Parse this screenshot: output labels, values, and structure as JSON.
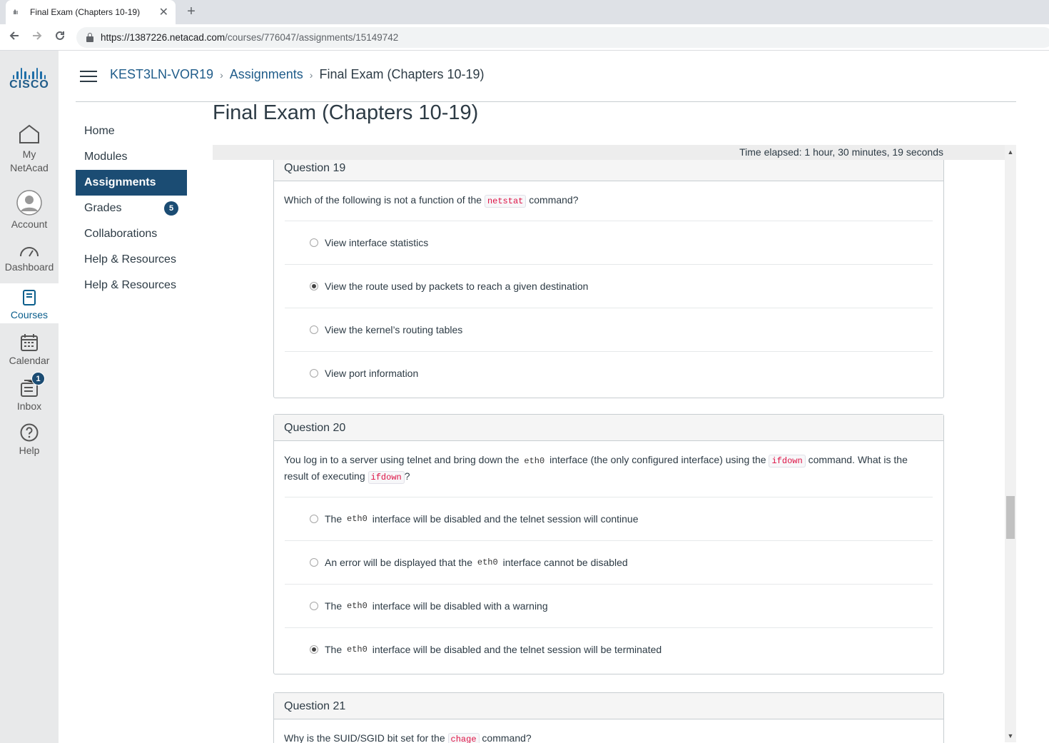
{
  "browser": {
    "tab_title": "Final Exam (Chapters 10-19)",
    "tab_close": "✕",
    "new_tab": "+",
    "url_host": "https://1387226.netacad.com",
    "url_path": "/courses/776047/assignments/15149742"
  },
  "global_nav": {
    "logo_text": "CISCO",
    "items": [
      {
        "label": "My NetAcad"
      },
      {
        "label": "Account"
      },
      {
        "label": "Dashboard"
      },
      {
        "label": "Courses"
      },
      {
        "label": "Calendar"
      },
      {
        "label": "Inbox",
        "badge": "1"
      },
      {
        "label": "Help"
      }
    ]
  },
  "breadcrumb": {
    "course": "KEST3LN-VOR19",
    "section": "Assignments",
    "current": "Final Exam (Chapters 10-19)",
    "separator": "›"
  },
  "course_nav": {
    "items": [
      "Home",
      "Modules",
      "Assignments",
      "Grades",
      "Collaborations",
      "Help & Resources",
      "Help & Resources"
    ],
    "grades_badge": "5"
  },
  "page_title": "Final Exam (Chapters 10-19)",
  "timer": "Time elapsed: 1 hour, 30 minutes, 19 seconds",
  "questions": [
    {
      "title": "Question 19",
      "text_pre": "Which of the following is not a function of the ",
      "text_code": "netstat",
      "text_post": " command?",
      "answers": [
        {
          "text": "View interface statistics",
          "selected": false
        },
        {
          "text": "View the route used by packets to reach a given destination",
          "selected": true
        },
        {
          "text": "View the kernel’s routing tables",
          "selected": false
        },
        {
          "text": "View port information",
          "selected": false
        }
      ]
    },
    {
      "title": "Question 20",
      "text_1": "You log in to a server using telnet and bring down the ",
      "code_1": "eth0",
      "text_2": " interface (the only configured interface) using the ",
      "code_2": "ifdown",
      "text_3": " command. What is the result of executing ",
      "code_3": "ifdown",
      "text_4": "?",
      "answers": [
        {
          "pre": "The ",
          "code": "eth0",
          "post": " interface will be disabled and the telnet session will continue",
          "selected": false
        },
        {
          "pre": "An error will be displayed that the ",
          "code": "eth0",
          "post": " interface cannot be disabled",
          "selected": false
        },
        {
          "pre": "The ",
          "code": "eth0",
          "post": " interface will be disabled with a warning",
          "selected": false
        },
        {
          "pre": "The ",
          "code": "eth0",
          "post": " interface will be disabled and the telnet session will be terminated",
          "selected": true
        }
      ]
    },
    {
      "title": "Question 21",
      "text_pre": "Why is the SUID/SGID bit set for the ",
      "text_code": "chage",
      "text_post": " command?"
    }
  ]
}
